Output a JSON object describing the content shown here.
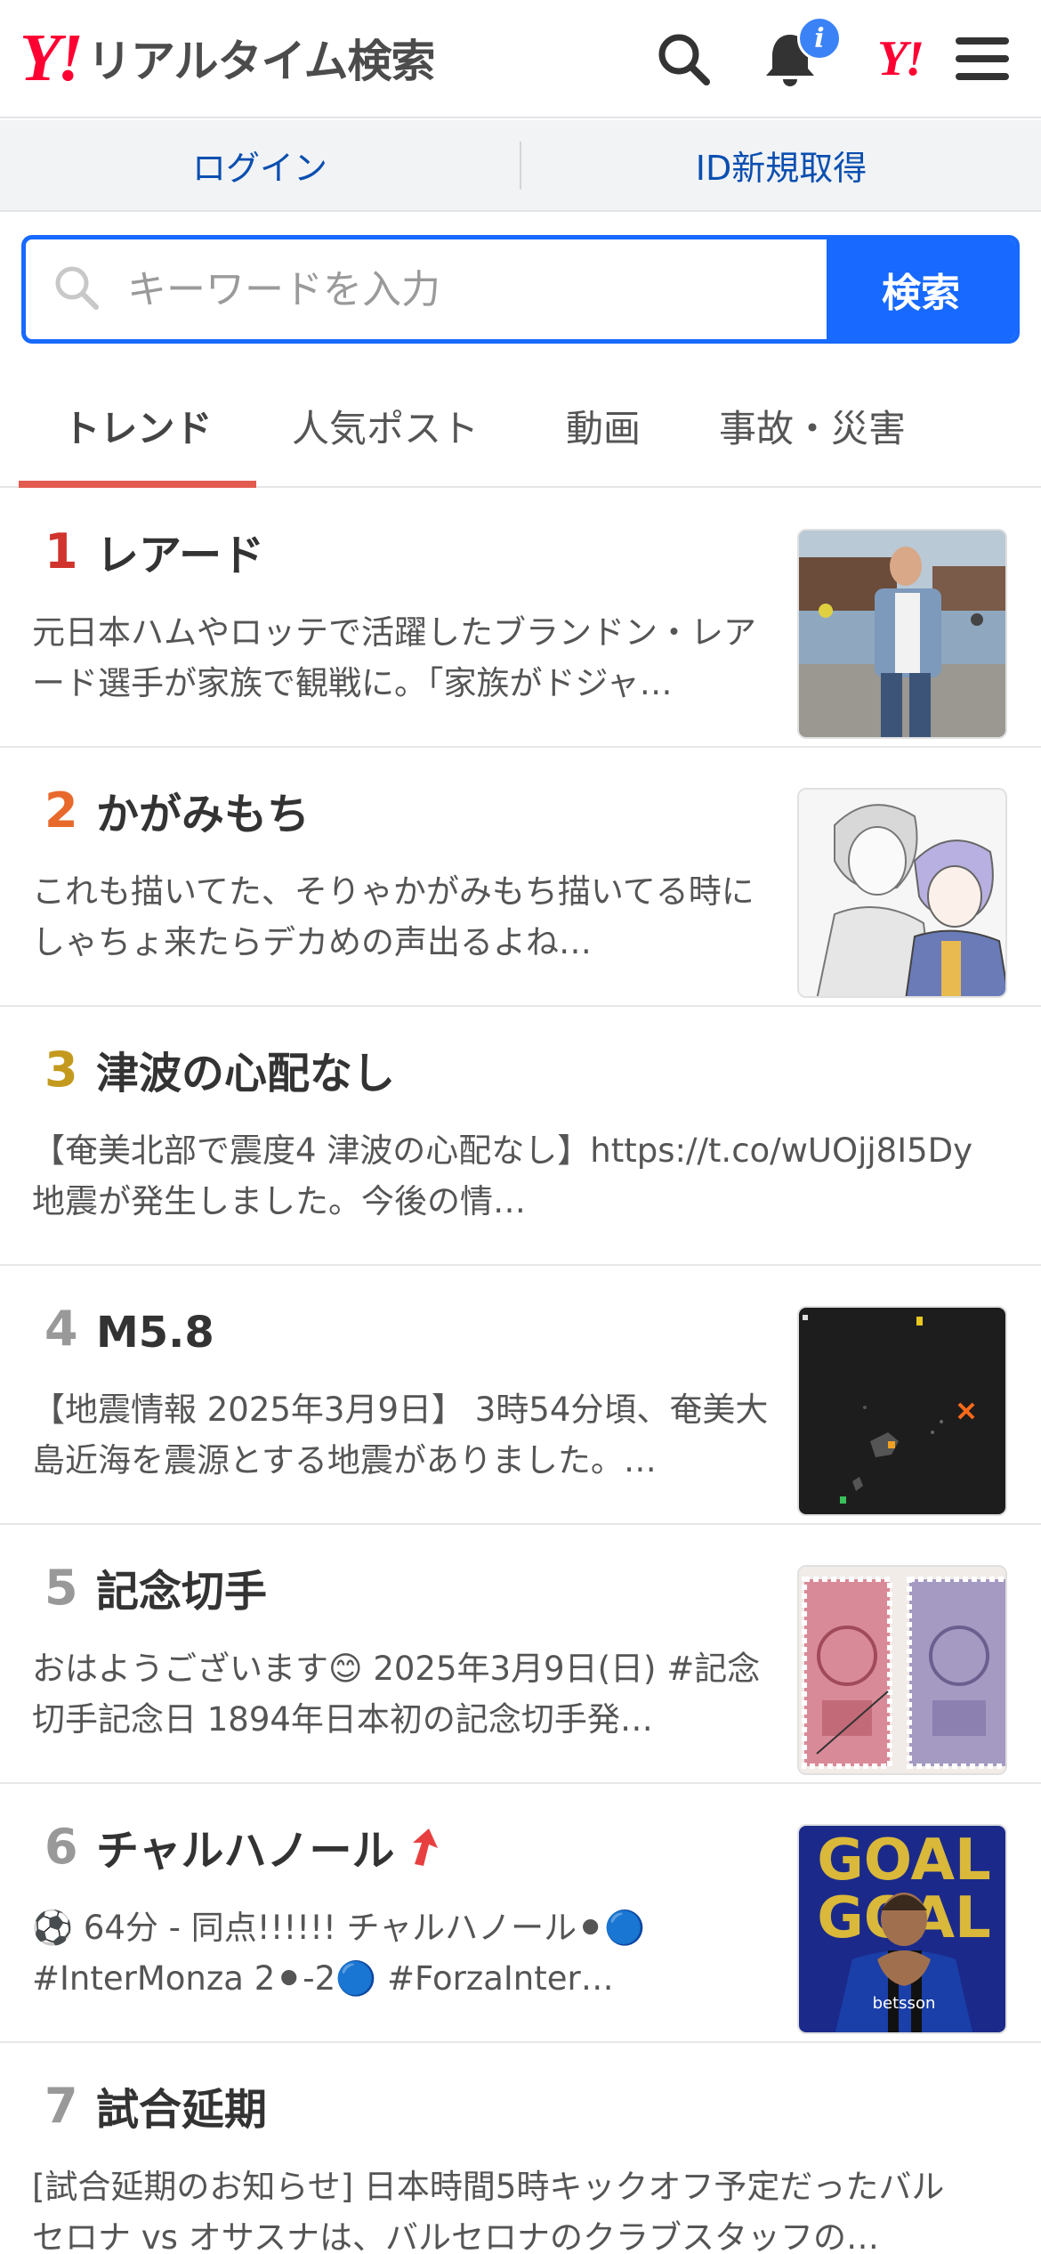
{
  "header": {
    "logo_mark": "Y!",
    "logo_text": "リアルタイム検索",
    "notification_badge": "i",
    "yahoo_mark": "Y!"
  },
  "account": {
    "login": "ログイン",
    "register": "ID新規取得"
  },
  "search": {
    "placeholder": "キーワードを入力",
    "button": "検索"
  },
  "tabs": [
    "トレンド",
    "人気ポスト",
    "動画",
    "事故・災害"
  ],
  "colors": {
    "accent_blue": "#1769ff",
    "rank1": "#d0342c",
    "rank2": "#e8692c",
    "rank3": "#c49a1e",
    "rank_other": "#999999",
    "tab_underline": "#e35b50"
  },
  "trends": [
    {
      "rank": "1",
      "title": "レアード",
      "desc": "元日本ハムやロッテで活躍したブランドン・レアード選手が家族で観戦に。「家族がドジャ…",
      "image": "man-photo"
    },
    {
      "rank": "2",
      "title": "かがみもち",
      "desc": "これも描いてた、そりゃかがみもち描いてる時にしゃちょ来たらデカめの声出るよね…",
      "image": "anime-illustration"
    },
    {
      "rank": "3",
      "title": "津波の心配なし",
      "desc": "【奄美北部で震度4 津波の心配なし】https://t.co/wUOjj8I5Dy 地震が発生しました。今後の情…",
      "image": null
    },
    {
      "rank": "4",
      "title": "M5.8",
      "desc": "【地震情報 2025年3月9日】 3時54分頃、奄美大島近海を震源とする地震がありました。…",
      "image": "earthquake-map"
    },
    {
      "rank": "5",
      "title": "記念切手",
      "desc": "おはようございます😊 2025年3月9日(日) #記念切手記念日 1894年日本初の記念切手発…",
      "image": "stamps"
    },
    {
      "rank": "6",
      "title": "チャルハノール",
      "desc": "⚽ 64分 - 同点!!!!!! チャルハノール⚫🔵 #InterMonza 2⚫-2🔵 #ForzaInter…",
      "image": "soccer-player",
      "rising": true
    },
    {
      "rank": "7",
      "title": "試合延期",
      "desc": "[試合延期のお知らせ] 日本時間5時キックオフ予定だったバルセロナ vs オサスナは、バルセロナのクラブスタッフの…",
      "image": null
    }
  ]
}
